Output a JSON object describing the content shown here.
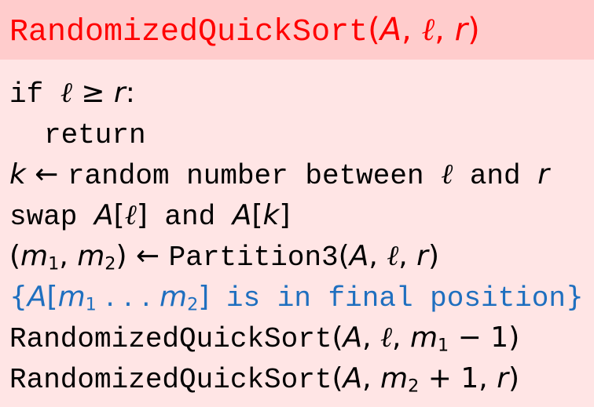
{
  "title": {
    "name": "RandomizedQuickSort",
    "open_paren": "(",
    "arg_a": "A",
    "comma1": ", ",
    "arg_l": "ℓ",
    "comma2": ", ",
    "arg_r": "r",
    "close_paren": ")"
  },
  "lines": [
    {
      "kw": "if",
      "sp": " ",
      "l": "ℓ",
      "op": " ≥ ",
      "r": "r",
      "colon": ":"
    },
    {
      "kw": "return"
    },
    {
      "k": "k",
      "arrow": " ← ",
      "text": "random number between",
      "sp": " ",
      "l": "ℓ",
      "and": " and ",
      "r": "r"
    },
    {
      "swap": "swap ",
      "a1": "A",
      "b1": "[",
      "l": "ℓ",
      "b2": "]",
      "and": " and ",
      "a2": "A",
      "b3": "[",
      "k": "k",
      "b4": "]"
    },
    {
      "lp": "(",
      "m": "m",
      "s1": "1",
      "comma": ", ",
      "m2": "m",
      "s2": "2",
      "rp": ")",
      "arrow": " ← ",
      "fn": "Partition3",
      "op": "(",
      "a": "A",
      "c1": ", ",
      "l": "ℓ",
      "c2": ", ",
      "r": "r",
      "cp": ")"
    },
    {
      "brace_open": "{",
      "a": "A",
      "b1": "[",
      "m": "m",
      "s1": "1",
      "dots": " . . . ",
      "m2": "m",
      "s2": "2",
      "b2": "]",
      "text": " is in final position",
      "brace_close": "}"
    },
    {
      "fn": "RandomizedQuickSort",
      "op": "(",
      "a": "A",
      "c1": ", ",
      "l": "ℓ",
      "c2": ", ",
      "m": "m",
      "s1": "1",
      "minus": " − 1",
      "cp": ")"
    },
    {
      "fn": "RandomizedQuickSort",
      "op": "(",
      "a": "A",
      "c1": ", ",
      "m": "m",
      "s2": "2",
      "plus": " + 1",
      "c2": ", ",
      "r": "r",
      "cp": ")"
    }
  ],
  "colors": {
    "header_bg": "#ffcccc",
    "body_bg": "#ffe5e5",
    "title": "#ff0000",
    "comment": "#1f6fbf",
    "text": "#000000"
  }
}
